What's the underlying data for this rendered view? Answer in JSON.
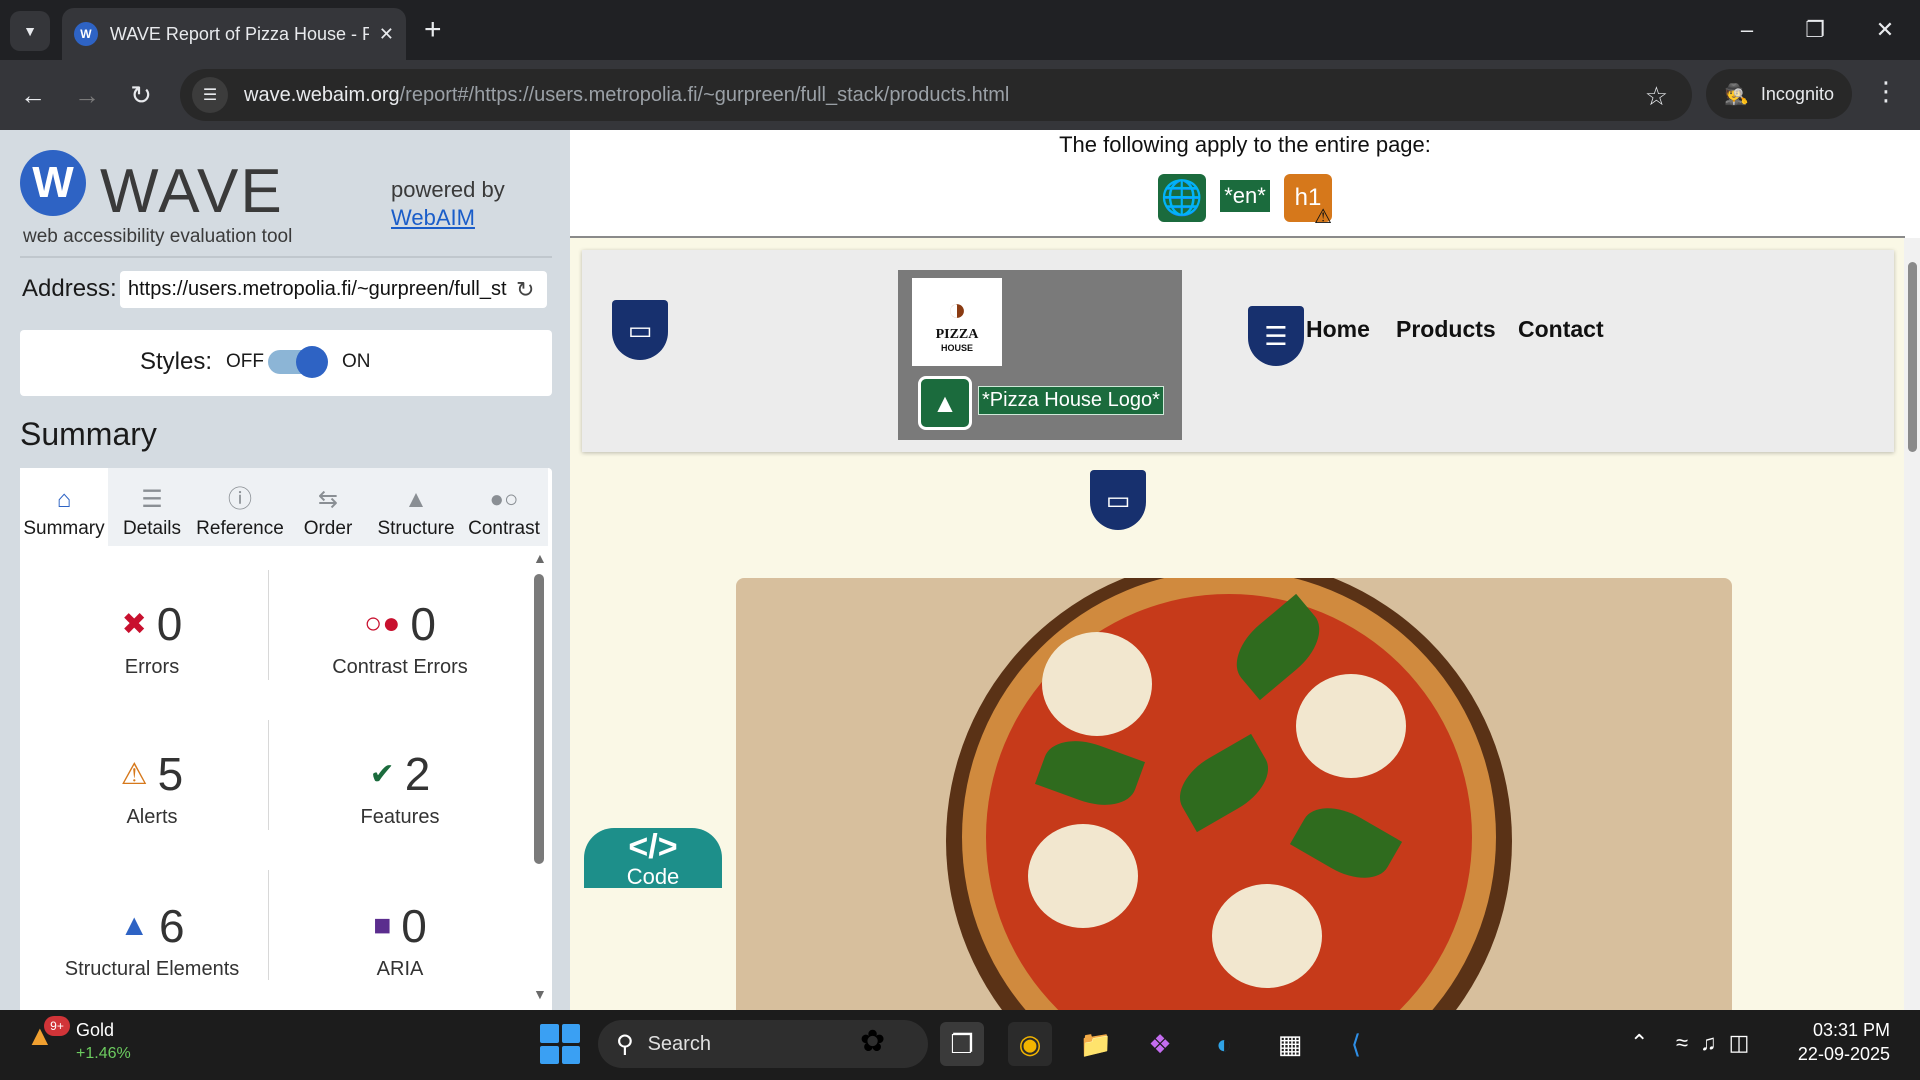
{
  "browser": {
    "tab_title": "WAVE Report of Pizza House - P",
    "url_domain": "wave.webaim.org",
    "url_path": "/report#/https://users.metropolia.fi/~gurpreen/full_stack/products.html",
    "incognito_label": "Incognito"
  },
  "wave": {
    "name": "WAVE",
    "subtitle": "web accessibility evaluation tool",
    "powered_by": "powered by",
    "webaim_link": "WebAIM",
    "address_label": "Address:",
    "address_value": "https://users.metropolia.fi/~gurpreen/full_st",
    "styles_label": "Styles:",
    "styles_off": "OFF",
    "styles_on": "ON",
    "styles_state": "on",
    "summary_title": "Summary",
    "tabs": [
      {
        "label": "Summary",
        "icon": "home-icon"
      },
      {
        "label": "Details",
        "icon": "list-icon"
      },
      {
        "label": "Reference",
        "icon": "info-icon"
      },
      {
        "label": "Order",
        "icon": "order-icon"
      },
      {
        "label": "Structure",
        "icon": "structure-icon"
      },
      {
        "label": "Contrast",
        "icon": "contrast-icon"
      }
    ],
    "stats": {
      "errors": {
        "value": "0",
        "label": "Errors"
      },
      "contrast_errors": {
        "value": "0",
        "label": "Contrast Errors"
      },
      "alerts": {
        "value": "5",
        "label": "Alerts"
      },
      "features": {
        "value": "2",
        "label": "Features"
      },
      "structural": {
        "value": "6",
        "label": "Structural Elements"
      },
      "aria": {
        "value": "0",
        "label": "ARIA"
      }
    }
  },
  "page": {
    "apply_text": "The following apply to the entire page:",
    "lang_badge": "*en*",
    "h1_badge": "h1",
    "logo_word": "PIZZA",
    "logo_house": "HOUSE",
    "logo_alt": "*Pizza House Logo*",
    "nav": [
      "Home",
      "Products",
      "Contact"
    ],
    "code_label": "Code"
  },
  "taskbar": {
    "stock_name": "Gold",
    "stock_change": "+1.46%",
    "stock_badge": "9+",
    "search_label": "Search",
    "time": "03:31 PM",
    "date": "22-09-2025"
  },
  "colors": {
    "wave_blue": "#2e63c4",
    "feature_green": "#1b6b3d",
    "alert_orange": "#d6781b",
    "structure_navy": "#17306e",
    "code_teal": "#1d8f8a"
  }
}
